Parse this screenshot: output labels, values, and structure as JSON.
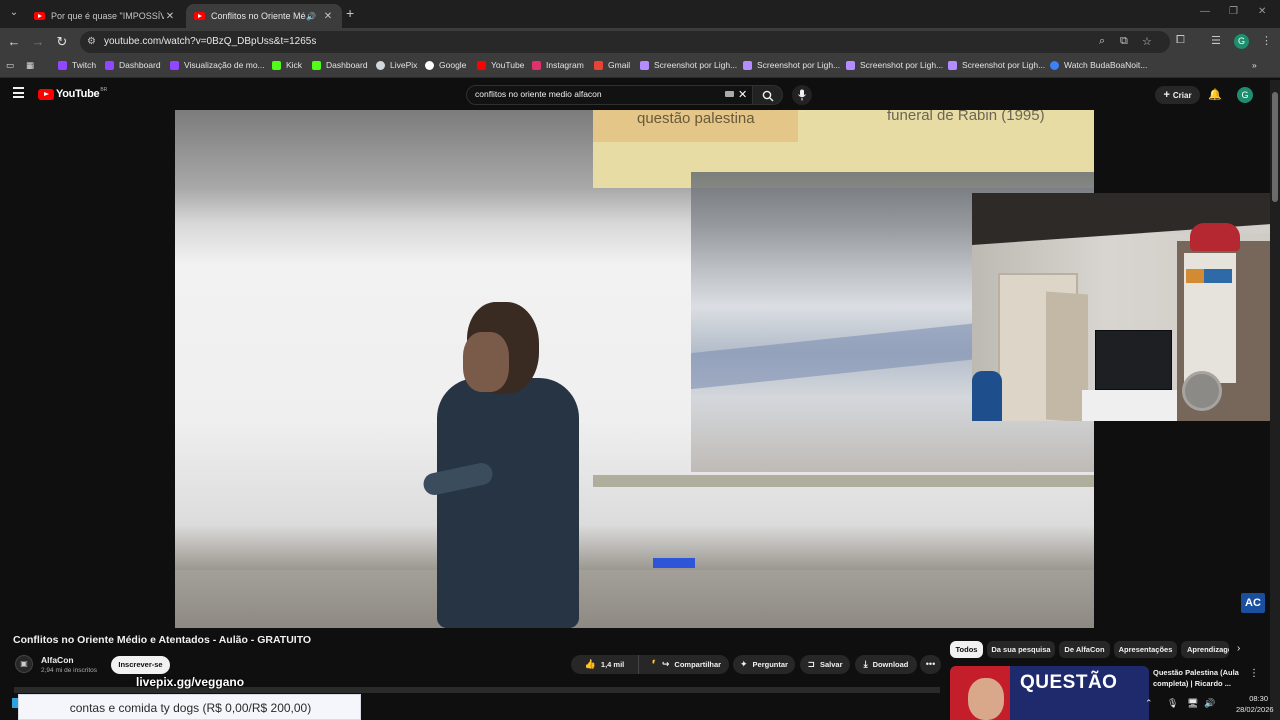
{
  "browser": {
    "tabs": [
      {
        "title": "Por que é quase \"IMPOSSÍVEL\"",
        "active": false
      },
      {
        "title": "Conflitos no Oriente Médio",
        "active": true
      }
    ],
    "url": "youtube.com/watch?v=0BzQ_DBpUss&t=1265s",
    "profile_initial": "G",
    "bookmarks": [
      {
        "label": "Twitch",
        "icon": "twitch-icon",
        "color": "#9146ff"
      },
      {
        "label": "Dashboard",
        "icon": "twitch-icon",
        "color": "#9146ff"
      },
      {
        "label": "Visualização de mo...",
        "icon": "twitch-icon",
        "color": "#9146ff"
      },
      {
        "label": "Kick",
        "icon": "kick-icon",
        "color": "#53fc18"
      },
      {
        "label": "Dashboard",
        "icon": "kick-icon",
        "color": "#53fc18"
      },
      {
        "label": "LivePix",
        "icon": "livepix-icon",
        "color": "#cfd8dc"
      },
      {
        "label": "Google",
        "icon": "google-icon",
        "color": "#ffffff"
      },
      {
        "label": "YouTube",
        "icon": "youtube-icon",
        "color": "#ff0000"
      },
      {
        "label": "Instagram",
        "icon": "instagram-icon",
        "color": "#e1306c"
      },
      {
        "label": "Gmail",
        "icon": "gmail-icon",
        "color": "#ea4335"
      },
      {
        "label": "Screenshot por Ligh...",
        "icon": "lightshot-icon",
        "color": "#b58cff"
      },
      {
        "label": "Screenshot por Ligh...",
        "icon": "lightshot-icon",
        "color": "#b58cff"
      },
      {
        "label": "Screenshot por Ligh...",
        "icon": "lightshot-icon",
        "color": "#b58cff"
      },
      {
        "label": "Screenshot por Ligh...",
        "icon": "lightshot-icon",
        "color": "#b58cff"
      },
      {
        "label": "Watch BudaBoaNoit...",
        "icon": "watch-icon",
        "color": "#3b82f6"
      }
    ]
  },
  "youtube": {
    "logo_text": "YouTube",
    "logo_country": "BR",
    "search_value": "conflitos no oriente medio alfacon",
    "create_label": "Criar",
    "avatar_initial": "G"
  },
  "video": {
    "slide_text_left": "questão palestina",
    "slide_text_right": "funeral de Rabin (1995)",
    "title": "Conflitos no Oriente Médio e Atentados - Aulão - GRATUITO",
    "channel": "AlfaCon",
    "subscribers": "2,94 mi de inscritos",
    "subscribe_label": "Inscrever-se",
    "likes": "1,4 mil",
    "share_label": "Compartilhar",
    "ask_label": "Perguntar",
    "save_label": "Salvar",
    "download_label": "Download",
    "watermark": "AC"
  },
  "sidebar": {
    "chips": [
      "Todos",
      "Da sua pesquisa",
      "De AlfaCon",
      "Apresentações",
      "Aprendizagem"
    ],
    "recommendation": {
      "thumb_text": "QUESTÃO",
      "title": "Questão Palestina (Aula completa) | Ricardo ..."
    }
  },
  "stream_overlay": {
    "link": "livepix.gg/veggano",
    "goal": "contas e comida ty dogs (R$ 0,00/R$ 200,00)"
  },
  "taskbar": {
    "time": "08:30",
    "date": "28/02/2026"
  }
}
